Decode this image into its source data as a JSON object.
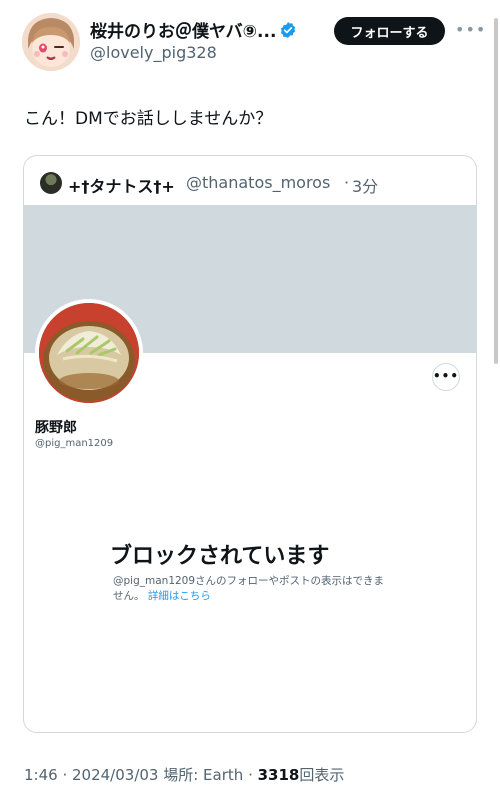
{
  "author": {
    "name": "桜井のりお＠僕ヤバ⑨...",
    "handle": "@lovely_pig328",
    "verified": true
  },
  "follow_label": "フォローする",
  "more_label": "•••",
  "tweet_text": "こん！DMでお話ししませんか？",
  "quote": {
    "author_name": "+†タナトス†+",
    "author_handle": "@thanatos_moros",
    "separator": "·",
    "time": "3分",
    "profile": {
      "name": "豚野郎",
      "handle": "@pig_man1209",
      "more_label": "•••"
    },
    "blocked": {
      "title": "ブロックされています",
      "body": "@pig_man1209さんのフォローやポストの表示はできません。",
      "link": "詳細はこちら"
    }
  },
  "meta": {
    "time": "1:46",
    "sep1": " · ",
    "date": "2024/03/03",
    "location": " 場所: Earth",
    "sep2": " · ",
    "views_count": "3318",
    "views_label": "回表示"
  },
  "colors": {
    "text_primary": "#0f1419",
    "text_secondary": "#536471",
    "accent": "#1d9bf0",
    "banner": "#cfd9de"
  }
}
